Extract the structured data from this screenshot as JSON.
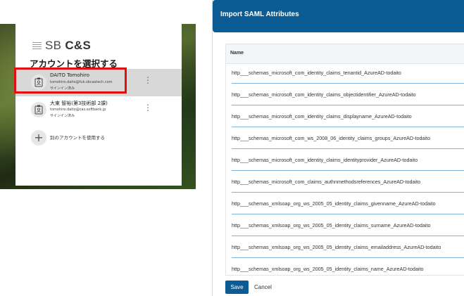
{
  "account_picker": {
    "logo_sb": "SB",
    "logo_cs": "C&S",
    "title": "アカウントを選択する",
    "accounts": [
      {
        "name": "DAITO Tomohiro",
        "email": "tomohiro.daito@fuk.sbcastech.com",
        "status": "サインイン済み"
      },
      {
        "name": "大東 智裕(第3技術部 2課)",
        "email": "tomohiro.daito@cas.softbank.jp",
        "status": "サインイン済み"
      }
    ],
    "more_glyph": "⋮",
    "use_other_label": "別のアカウントを使用する",
    "use_other_glyph": "+"
  },
  "dialog": {
    "title": "Import SAML Attributes",
    "column_header": "Name",
    "rows": [
      "http___schemas_microsoft_com_identity_claims_tenantid_AzureAD-todaito",
      "http___schemas_microsoft_com_identity_claims_objectidentifier_AzureAD-todaito",
      "http___schemas_microsoft_com_identity_claims_displayname_AzureAD-todaito",
      "http___schemas_microsoft_com_ws_2008_06_identity_claims_groups_AzureAD-todaito",
      "http___schemas_microsoft_com_identity_claims_identityprovider_AzureAD-todaito",
      "http___schemas_microsoft_com_claims_authnmethodsreferences_AzureAD-todaito",
      "http___schemas_xmlsoap_org_ws_2005_05_identity_claims_givenname_AzureAD-todaito",
      "http___schemas_xmlsoap_org_ws_2005_05_identity_claims_surname_AzureAD-todaito",
      "http___schemas_xmlsoap_org_ws_2005_05_identity_claims_emailaddress_AzureAD-todaito",
      "http___schemas_xmlsoap_org_ws_2005_05_identity_claims_name_AzureAD-todaito"
    ],
    "save_label": "Save",
    "cancel_label": "Cancel"
  },
  "colors": {
    "header_blue": "#0b5c94",
    "highlight_red": "#e01010",
    "row_underline": "#7fb3db"
  }
}
